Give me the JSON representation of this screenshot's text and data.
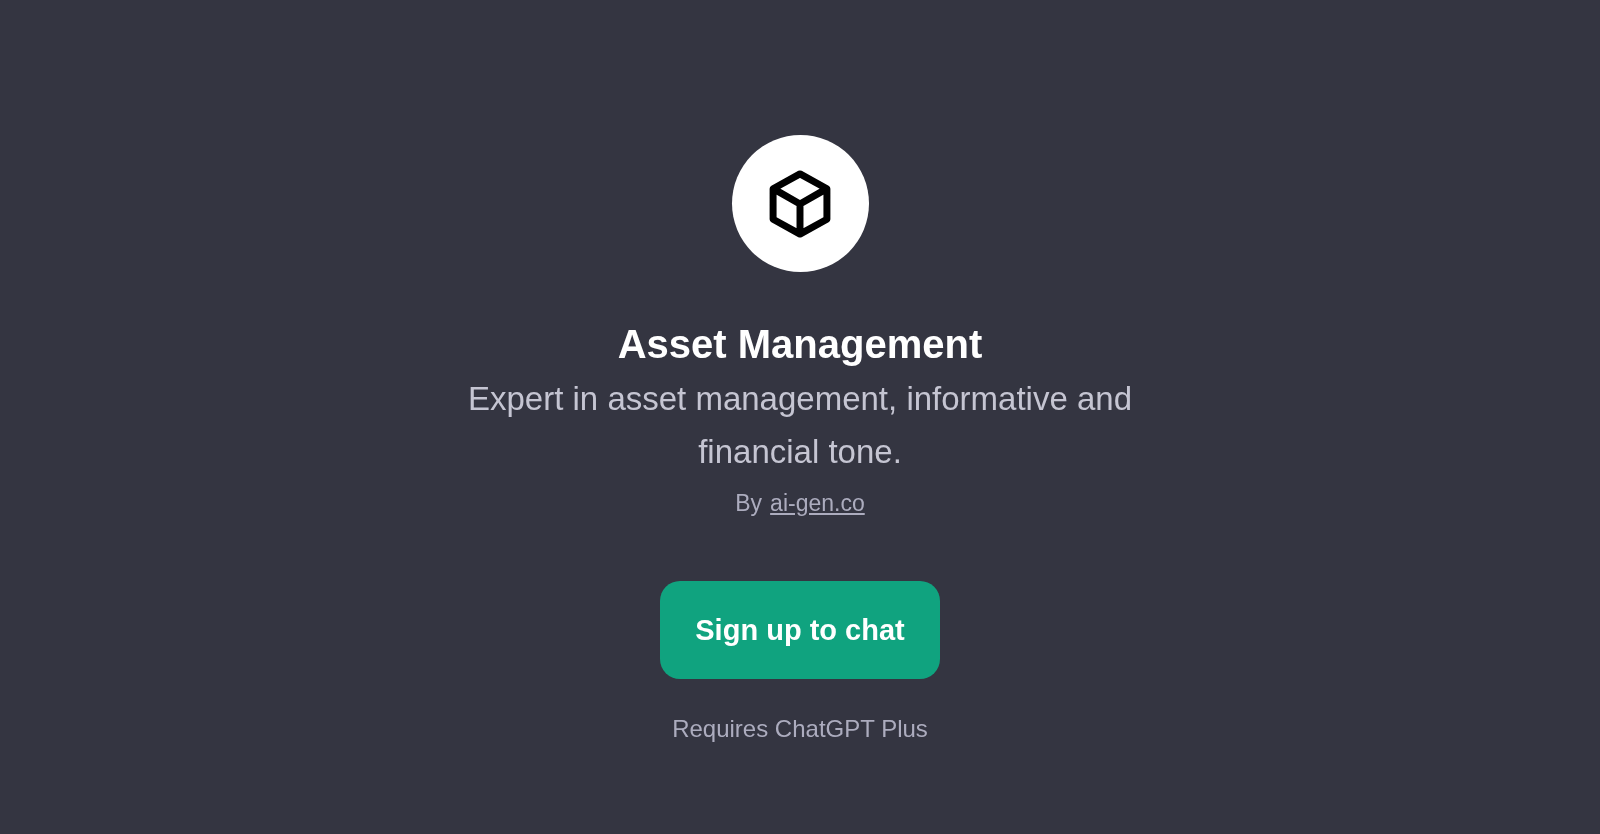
{
  "title": "Asset Management",
  "description": "Expert in asset management, informative and financial tone.",
  "author": {
    "prefix": "By",
    "link": "ai-gen.co"
  },
  "button": "Sign up to chat",
  "note": "Requires ChatGPT Plus"
}
